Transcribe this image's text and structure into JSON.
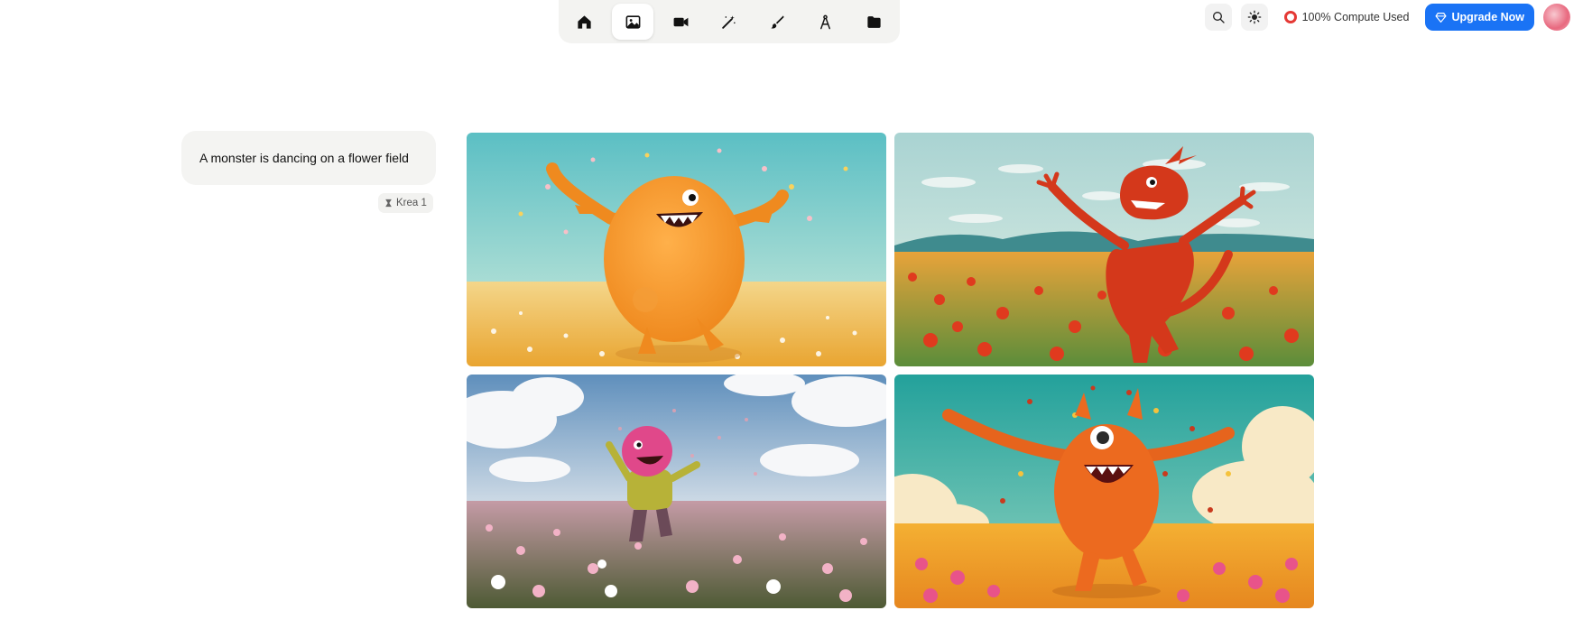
{
  "topnav": {
    "items": [
      {
        "icon": "home-icon"
      },
      {
        "icon": "image-icon",
        "active": true
      },
      {
        "icon": "video-icon"
      },
      {
        "icon": "magic-wand-icon"
      },
      {
        "icon": "brush-icon"
      },
      {
        "icon": "compass-icon"
      },
      {
        "icon": "folder-icon"
      }
    ]
  },
  "toolbar": {
    "compute_label": "100% Compute Used",
    "upgrade_label": "Upgrade Now",
    "accent": "#1a73f5",
    "compute_color": "#e53935"
  },
  "prompt": {
    "text": "A monster is dancing on a flower field",
    "model": "Krea 1"
  },
  "results": [
    {
      "alt": "orange fluffy monster dancing in yellow flower field"
    },
    {
      "alt": "red dragon-like monster dancing in red flower field"
    },
    {
      "alt": "pink-haired furry monster throwing petals in pink flower field"
    },
    {
      "alt": "orange horned monster dancing among petals in flower field"
    }
  ]
}
